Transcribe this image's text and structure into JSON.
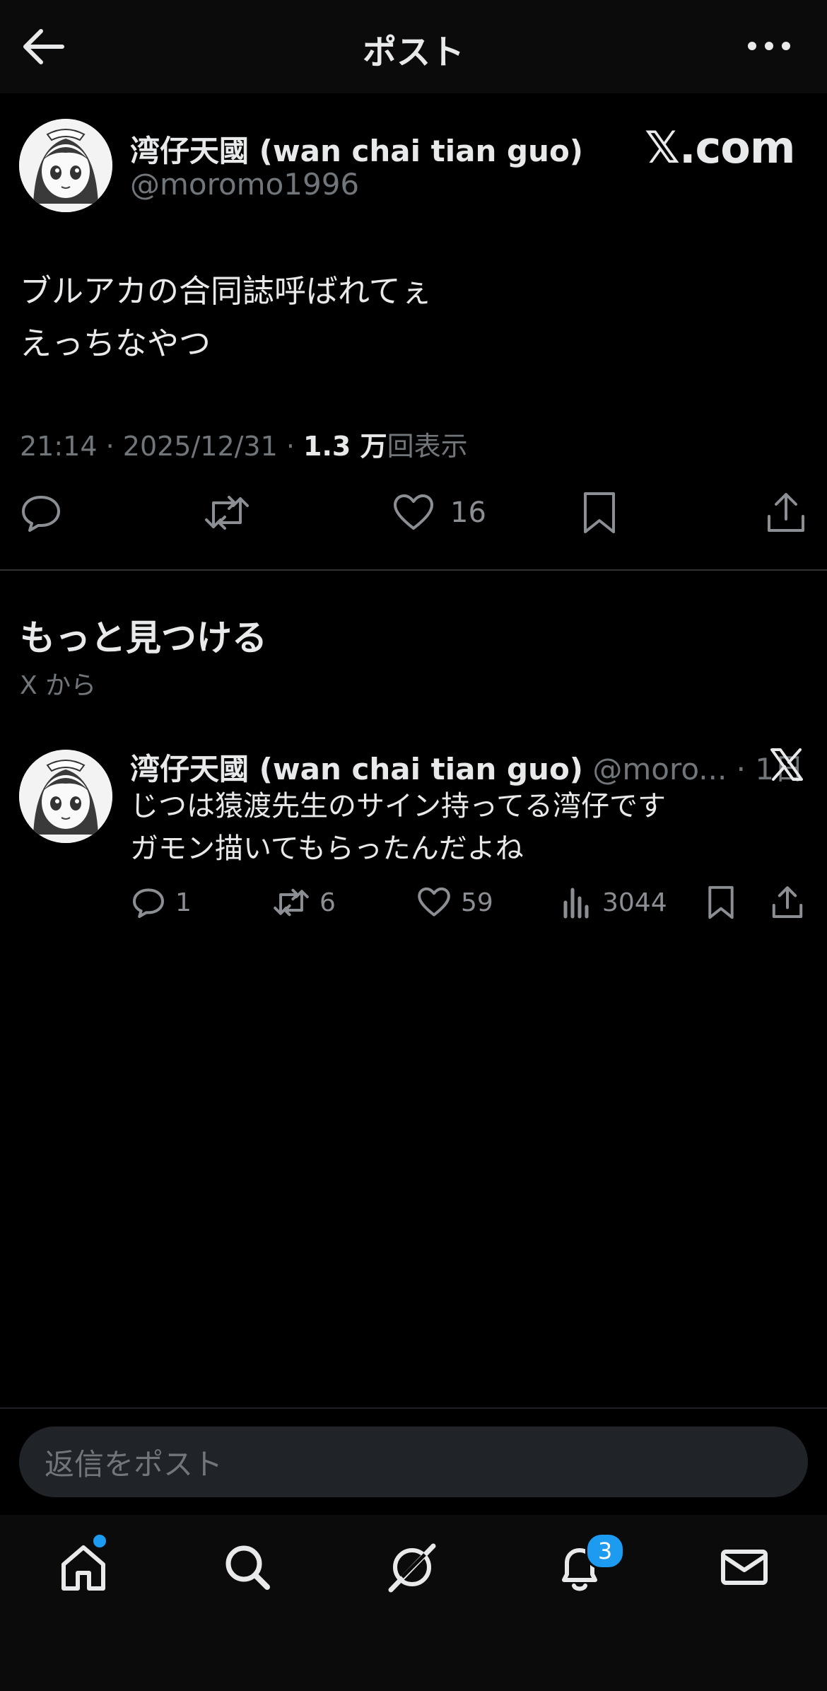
{
  "header": {
    "title": "ポスト"
  },
  "post": {
    "display_name": "湾仔天國 (wan chai tian guo)",
    "handle": "@moromo1996",
    "source_brand": "𝕏.com",
    "text_lines": [
      "ブルアカの合同誌呼ばれてぇ",
      "えっちなやつ"
    ],
    "time": "21:14",
    "date": "2025/12/31",
    "views_value": "1.3 万",
    "views_label": "回表示",
    "like_count": "16"
  },
  "discover": {
    "title": "もっと見つける",
    "subtitle": "X から",
    "item": {
      "display_name": "湾仔天國 (wan chai tian guo)",
      "handle": "@moro...",
      "age": "1日",
      "text_lines": [
        "じつは猿渡先生のサイン持ってる湾仔です",
        "ガモン描いてもらったんだよね"
      ],
      "reply_count": "1",
      "repost_count": "6",
      "like_count": "59",
      "view_count": "3044"
    }
  },
  "reply_bar": {
    "placeholder": "返信をポスト"
  },
  "nav": {
    "items": [
      "home-icon",
      "search-icon",
      "grok-icon",
      "notifications-icon",
      "messages-icon"
    ],
    "notification_badge": "3"
  },
  "colors": {
    "accent": "#1d9bf0",
    "muted": "#71767b",
    "text": "#e7e9ea"
  }
}
